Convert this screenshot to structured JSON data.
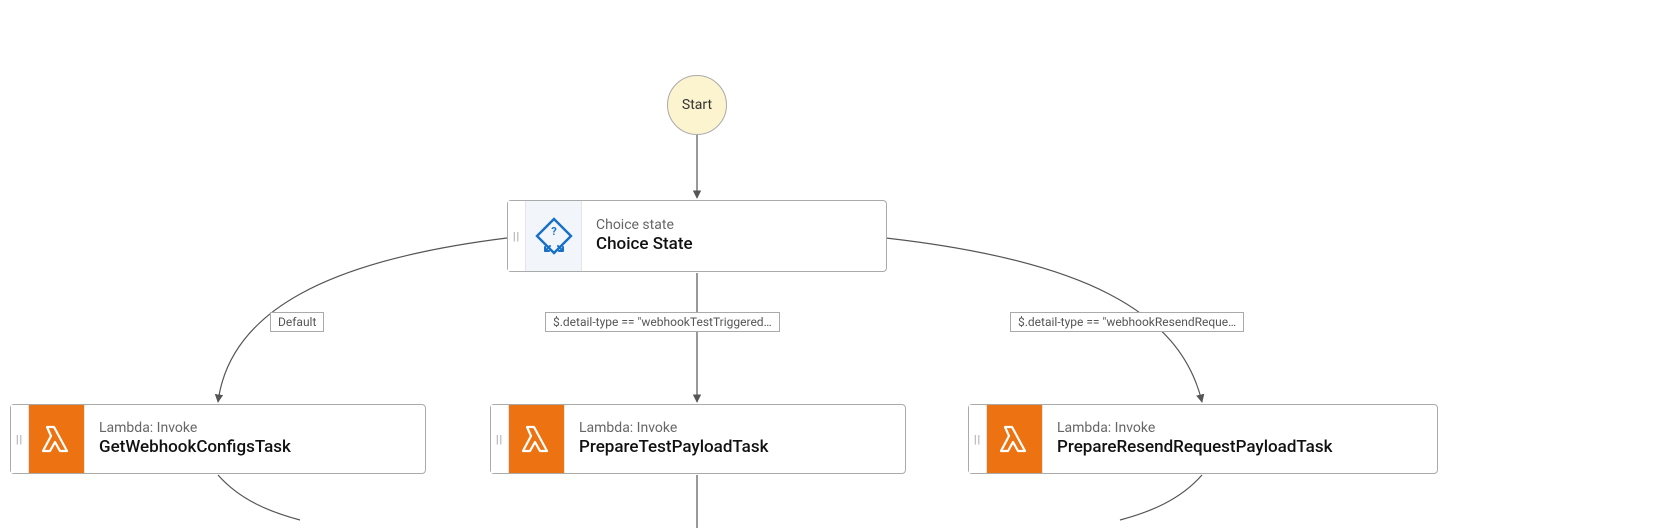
{
  "start": {
    "label": "Start"
  },
  "choice": {
    "type_label": "Choice state",
    "title": "Choice State"
  },
  "edges": {
    "default_label": "Default",
    "test_label": "$.detail-type == \"webhookTestTriggered…",
    "resend_label": "$.detail-type == \"webhookResendReque…"
  },
  "tasks": {
    "get_configs": {
      "type_label": "Lambda: Invoke",
      "title": "GetWebhookConfigsTask"
    },
    "prepare_test": {
      "type_label": "Lambda: Invoke",
      "title": "PrepareTestPayloadTask"
    },
    "prepare_resend": {
      "type_label": "Lambda: Invoke",
      "title": "PrepareResendRequestPayloadTask"
    }
  },
  "icons": {
    "choice": "choice-branch-icon",
    "lambda": "lambda-icon"
  }
}
